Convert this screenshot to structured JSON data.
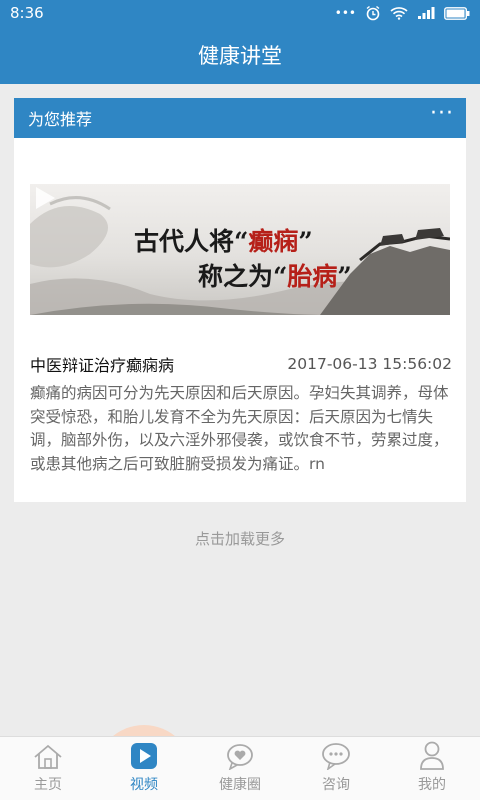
{
  "status_bar": {
    "time": "8:36",
    "battery": "battery-icon",
    "wifi": "wifi-icon",
    "signal": "signal-icon",
    "alarm": "alarm-icon"
  },
  "header": {
    "title": "健康讲堂"
  },
  "recommend": {
    "title": "为您推荐",
    "more": "···",
    "video": {
      "line1_prefix": "古代人将“",
      "line1_red": "癫痫",
      "line1_suffix": "”",
      "line2_prefix": "称之为“",
      "line2_red": "胎病",
      "line2_suffix": "”"
    },
    "article": {
      "title": "中医辩证治疗癫痫病",
      "date": "2017-06-13 15:56:02",
      "summary": "癫痛的病因可分为先天原因和后天原因。孕妇失其调养，母体突受惊恐，和胎儿发育不全为先天原因：后天原因为七情失调，脑部外伤，以及六淫外邪侵袭，或饮食不节，劳累过度，或患其他病之后可致脏腑受损发为痛证。rn"
    }
  },
  "load_more": "点击加载更多",
  "tabs": [
    {
      "label": "主页",
      "icon": "home-icon",
      "active": false
    },
    {
      "label": "视频",
      "icon": "video-icon",
      "active": true
    },
    {
      "label": "健康圈",
      "icon": "heart-circle-icon",
      "active": false
    },
    {
      "label": "咨询",
      "icon": "chat-icon",
      "active": false
    },
    {
      "label": "我的",
      "icon": "user-icon",
      "active": false
    }
  ],
  "colors": {
    "primary": "#2f86c4",
    "active_tab_bg": "#f8d8c5",
    "accent_red": "#b62019"
  }
}
